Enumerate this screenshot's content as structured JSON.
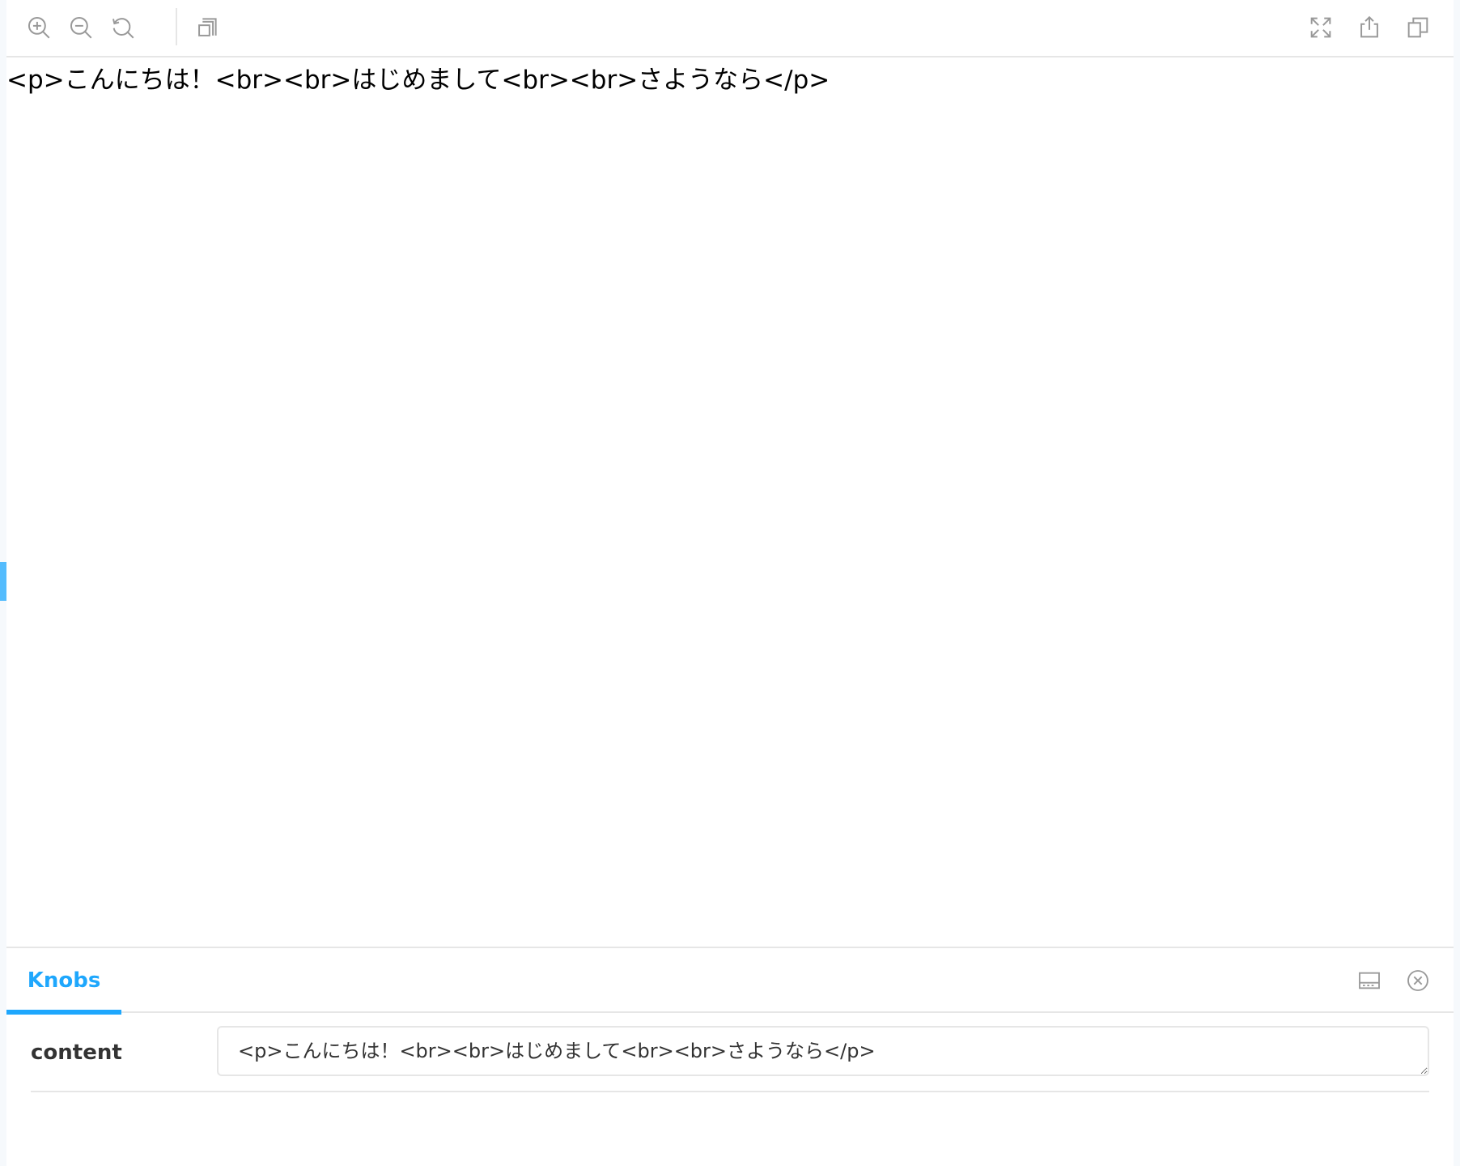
{
  "toolbar": {
    "left_icons": [
      "zoom-in-icon",
      "zoom-out-icon",
      "zoom-reset-icon",
      "background-grid-icon"
    ],
    "right_icons": [
      "fullscreen-icon",
      "share-icon",
      "copy-icon"
    ]
  },
  "preview": {
    "content": "<p>こんにちは！<br><br>はじめまして<br><br>さようなら</p>"
  },
  "addons": {
    "tabs": [
      {
        "label": "Knobs",
        "active": true
      }
    ],
    "icons": [
      "panel-position-icon",
      "close-panel-icon"
    ]
  },
  "knobs": [
    {
      "label": "content",
      "value": "<p>こんにちは！<br><br>はじめまして<br><br>さようなら</p>"
    }
  ],
  "colors": {
    "accent": "#1ea7fd",
    "icon": "#999999",
    "border": "#e6e6e6",
    "text": "#333333"
  }
}
